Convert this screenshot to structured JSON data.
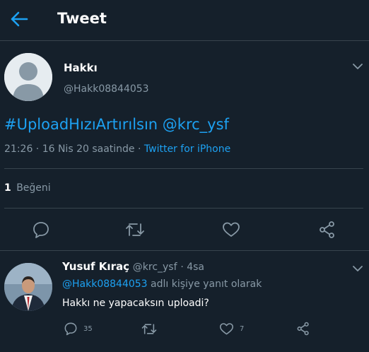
{
  "header": {
    "title": "Tweet",
    "back_icon": "arrow-left-icon"
  },
  "tweet": {
    "author_name": "Hakkı",
    "author_handle": "@Hakk08844053",
    "text": "#UploadHızıArtırılsın @krc_ysf",
    "timestamp": "21:26 · 16 Nis 20 saatinde ·",
    "source": "Twitter for iPhone",
    "like_count": "1",
    "like_label": "Beğeni",
    "actions": [
      "reply-icon",
      "retweet-icon",
      "like-icon",
      "share-icon"
    ]
  },
  "reply": {
    "author_name": "Yusuf Kıraç",
    "author_handle": "@krc_ysf",
    "time": "· 4sa",
    "mention": "@Hakk08844053",
    "context_suffix": "adlı kişiye yanıt olarak",
    "text": "Hakkı ne yapacaksın uploadi?",
    "reply_count": "35",
    "like_count": "7"
  },
  "colors": {
    "background": "#15202b",
    "accent": "#1da1f2",
    "secondary_text": "#8899a6",
    "divider": "#38444d"
  }
}
